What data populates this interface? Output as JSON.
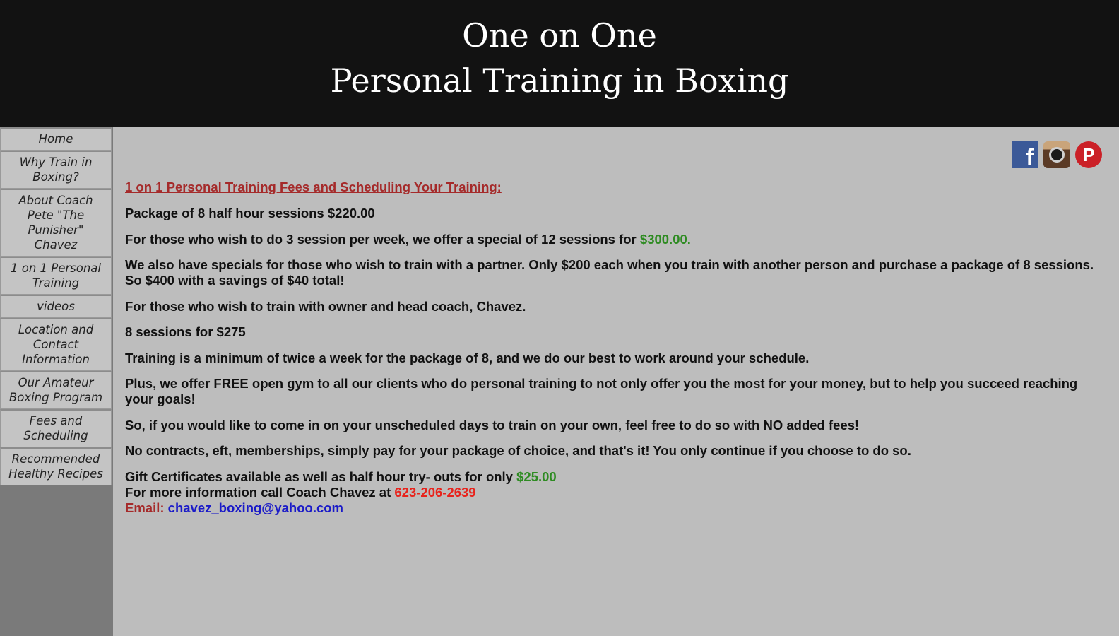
{
  "header": {
    "line1": "One on One",
    "line2": "Personal Training in Boxing"
  },
  "nav": {
    "home": "Home",
    "why_train": "Why Train in Boxing?",
    "about_coach": "About Coach Pete \"The Punisher\" Chavez",
    "personal_training": "1 on 1 Personal Training",
    "videos": "videos",
    "location": "Location and Contact Information",
    "amateur": "Our Amateur Boxing Program",
    "fees": "Fees and Scheduling",
    "recipes": "Recommended Healthy Recipes"
  },
  "social": {
    "facebook_glyph": "f",
    "pinterest_glyph": "P"
  },
  "content": {
    "heading": "1 on 1 Personal Training Fees and Scheduling Your Training:",
    "p1": "Package of 8 half hour sessions $220.00",
    "p2_text": "For those who wish to do 3 session per week, we offer a special of 12 sessions for ",
    "p2_price": "$300.00.",
    "p3": "We also have specials for those who wish to train with a partner. Only $200 each when you train with another person and purchase a package of 8 sessions. So $400 with a savings of $40 total!",
    "p4": "For those who wish to train with owner and head coach, Chavez.",
    "p5": "8 sessions for $275",
    "p6": "Training is a minimum of twice a week for the package of 8, and we do our best to work around your schedule.",
    "p7": "Plus, we offer FREE open gym to all our clients who do personal training to not only offer you the most for your money, but to help you succeed reaching your goals!",
    "p8": "So, if you would like to come in on your unscheduled days to train on your own, feel free to do so with NO added fees!",
    "p9": "No contracts, eft, memberships, simply pay for your package of choice, and that's it! You only continue if you choose to do so.",
    "gift_text": "Gift Certificates available as well as half hour try- outs for only ",
    "gift_price": "$25.00",
    "call_text": "For more information call Coach Chavez  at ",
    "phone": "623-206-2639",
    "email_label": "Email: ",
    "email": "chavez_boxing@yahoo.com"
  },
  "colors": {
    "header_bg": "#121212",
    "page_bg": "#bdbdbd",
    "heading": "#a52a2a",
    "price_green": "#2e8b22",
    "phone_red": "#e8231c",
    "link_blue": "#1a1ac8"
  }
}
